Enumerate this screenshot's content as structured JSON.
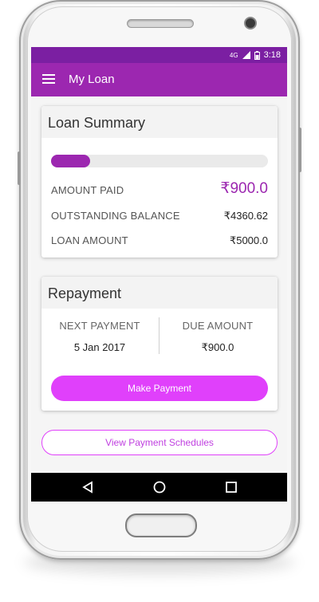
{
  "status_bar": {
    "network": "4G",
    "time": "3:18"
  },
  "app_bar": {
    "title": "My Loan",
    "menu_icon": "menu-icon"
  },
  "loan_summary": {
    "title": "Loan Summary",
    "progress_fraction": 0.18,
    "rows": [
      {
        "label": "AMOUNT PAID",
        "value": "₹900.0"
      },
      {
        "label": "OUTSTANDING BALANCE",
        "value": "₹4360.62"
      },
      {
        "label": "LOAN AMOUNT",
        "value": "₹5000.0"
      }
    ]
  },
  "repayment": {
    "title": "Repayment",
    "next_payment_label": "NEXT PAYMENT",
    "next_payment_value": "5 Jan 2017",
    "due_amount_label": "DUE AMOUNT",
    "due_amount_value": "₹900.0",
    "make_payment_label": "Make Payment"
  },
  "view_schedules_label": "View Payment Schedules",
  "colors": {
    "primary": "#9c27b0",
    "primary_dark": "#7b1fa2",
    "accent": "#e040fb"
  }
}
